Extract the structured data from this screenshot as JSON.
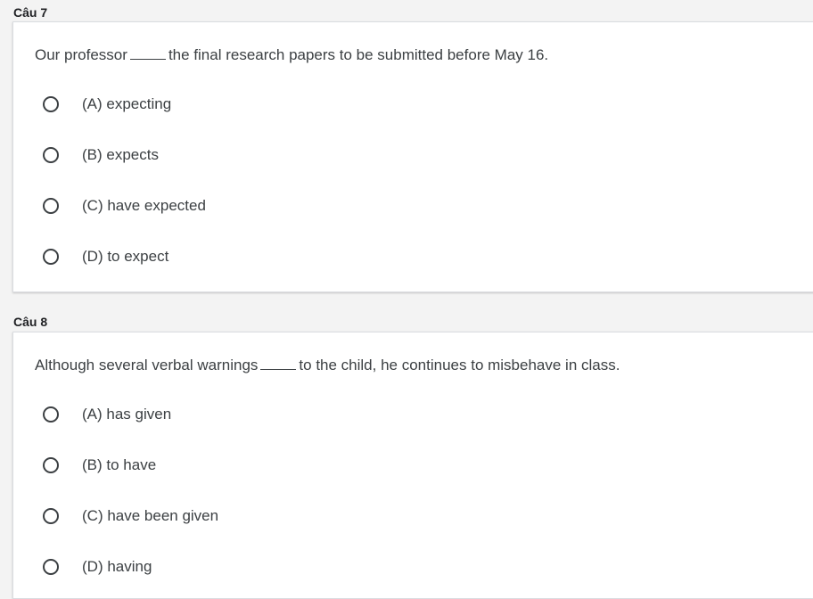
{
  "questions": [
    {
      "heading": "Câu 7",
      "text_before": "Our professor",
      "text_after": "the final research papers to be submitted before May 16.",
      "options": [
        "(A) expecting",
        "(B) expects",
        "(C) have expected",
        "(D) to expect"
      ]
    },
    {
      "heading": "Câu 8",
      "text_before": "Although several verbal warnings",
      "text_after": "to the child, he continues to misbehave in class.",
      "options": [
        "(A) has given",
        "(B) to have",
        "(C) have been given",
        "(D) having"
      ]
    }
  ]
}
